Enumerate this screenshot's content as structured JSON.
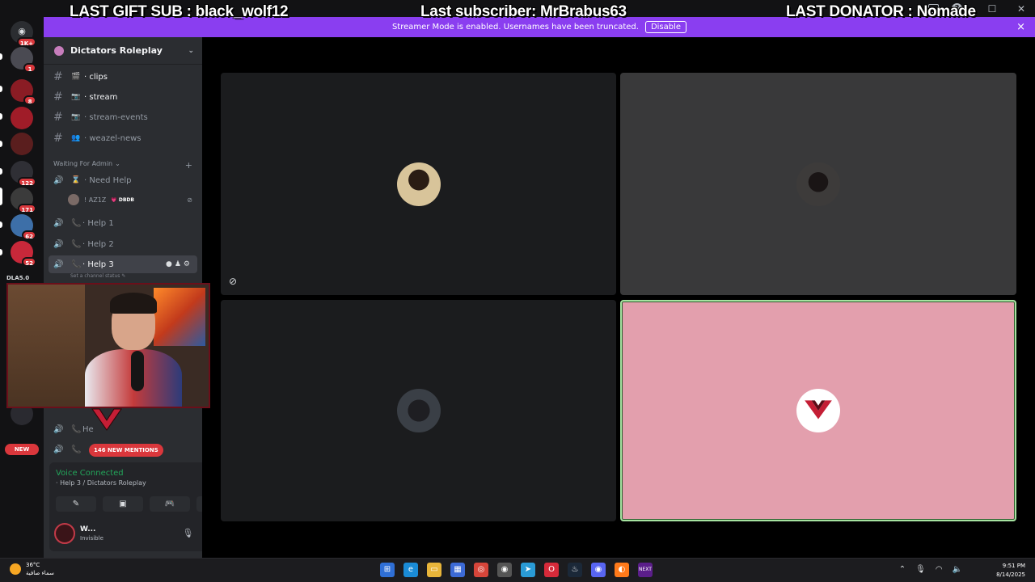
{
  "overlay": {
    "gift": "LAST GIFT SUB : black_wolf12",
    "subscriber": "Last subscriber: MrBrabus63",
    "donator": "LAST DONATOR : Nomade"
  },
  "banner": {
    "text": "Streamer Mode is enabled. Usernames have been truncated.",
    "disable_label": "Disable",
    "close_icon": "×"
  },
  "window": {
    "minimize": "—",
    "maximize": "☐",
    "close": "✕",
    "help": "?"
  },
  "rail": {
    "dm_badge": "1K+",
    "servers": [
      {
        "badge": "1",
        "color": "#4a4a52"
      },
      {
        "badge": "8",
        "color": "#8a1c24"
      },
      {
        "badge": "",
        "color": "#a01c28"
      },
      {
        "badge": "",
        "color": "#5a1e1e"
      },
      {
        "badge": "122",
        "color": "#2f2f35"
      },
      {
        "badge": "171",
        "color": "#3b3b3b"
      },
      {
        "badge": "62",
        "color": "#3d6fa8"
      },
      {
        "badge": "52",
        "color": "#c8283a"
      }
    ],
    "label": "DLA5.0",
    "new_label": "NEW"
  },
  "sidebar": {
    "guild_name": "Dictators Roleplay",
    "channels": [
      {
        "name": "clips",
        "emoji": "🎬"
      },
      {
        "name": "stream",
        "emoji": "📷"
      },
      {
        "name": "stream-events",
        "emoji": "📷"
      },
      {
        "name": "weazel-news",
        "emoji": "👥"
      }
    ],
    "category": "Waiting For Admin",
    "voice": [
      {
        "name": "Need Help",
        "emoji": "⌛"
      },
      {
        "name": "Help 1",
        "emoji": "📞"
      },
      {
        "name": "Help 2",
        "emoji": "📞"
      },
      {
        "name": "Help 3",
        "emoji": "📞"
      },
      {
        "name": "He",
        "emoji": "📞"
      }
    ],
    "voice_user": {
      "name": "! AZ1Z",
      "tag": "💗 DBDB"
    },
    "channel_status": "Set a channel status ✎",
    "mentions": "146 NEW MENTIONS"
  },
  "voice_panel": {
    "status": "Voice Connected",
    "location": "· Help 3 / Dictators Roleplay"
  },
  "user_panel": {
    "name": "W...",
    "status": "Invisible"
  },
  "taskbar": {
    "temp": "36°C",
    "weather": "سماء صافية",
    "time": "9:51 PM",
    "date": "8/14/2025"
  }
}
